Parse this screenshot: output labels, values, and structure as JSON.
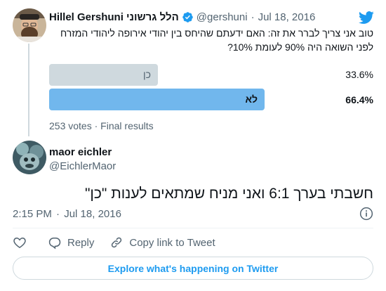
{
  "parent_tweet": {
    "author_name": "Hillel Gershuni הלל גרשוני",
    "author_handle": "@gershuni",
    "separator": "·",
    "date": "Jul 18, 2016",
    "text": "טוב אני צריך לברר את זה: האם ידעתם שהיחס בין יהודי אירופה ליהודי המזרח לפני השואה היה 90% לעומת 10%?",
    "poll": {
      "options": [
        {
          "label": "כן",
          "percent": "33.6%",
          "fraction": 0.336,
          "winner": false
        },
        {
          "label": "לא",
          "percent": "66.4%",
          "fraction": 0.664,
          "winner": true
        }
      ],
      "votes": "253 votes",
      "status": "Final results",
      "meta_separator": " · "
    }
  },
  "reply_tweet": {
    "author_name": "maor eichler",
    "author_handle": "@EichlerMaor",
    "text": "חשבתי בערך 6:1 ואני מניח שמתאים לענות \"כן\"",
    "time": "2:15 PM",
    "separator": "·",
    "date": "Jul 18, 2016"
  },
  "actions": {
    "reply_label": "Reply",
    "copy_link_label": "Copy link to Tweet"
  },
  "explore_label": "Explore what's happening on Twitter",
  "colors": {
    "brand": "#1d9bf0",
    "poll_winner": "#71b7ed",
    "poll_loser": "#cfd9de",
    "muted_text": "#536471"
  }
}
